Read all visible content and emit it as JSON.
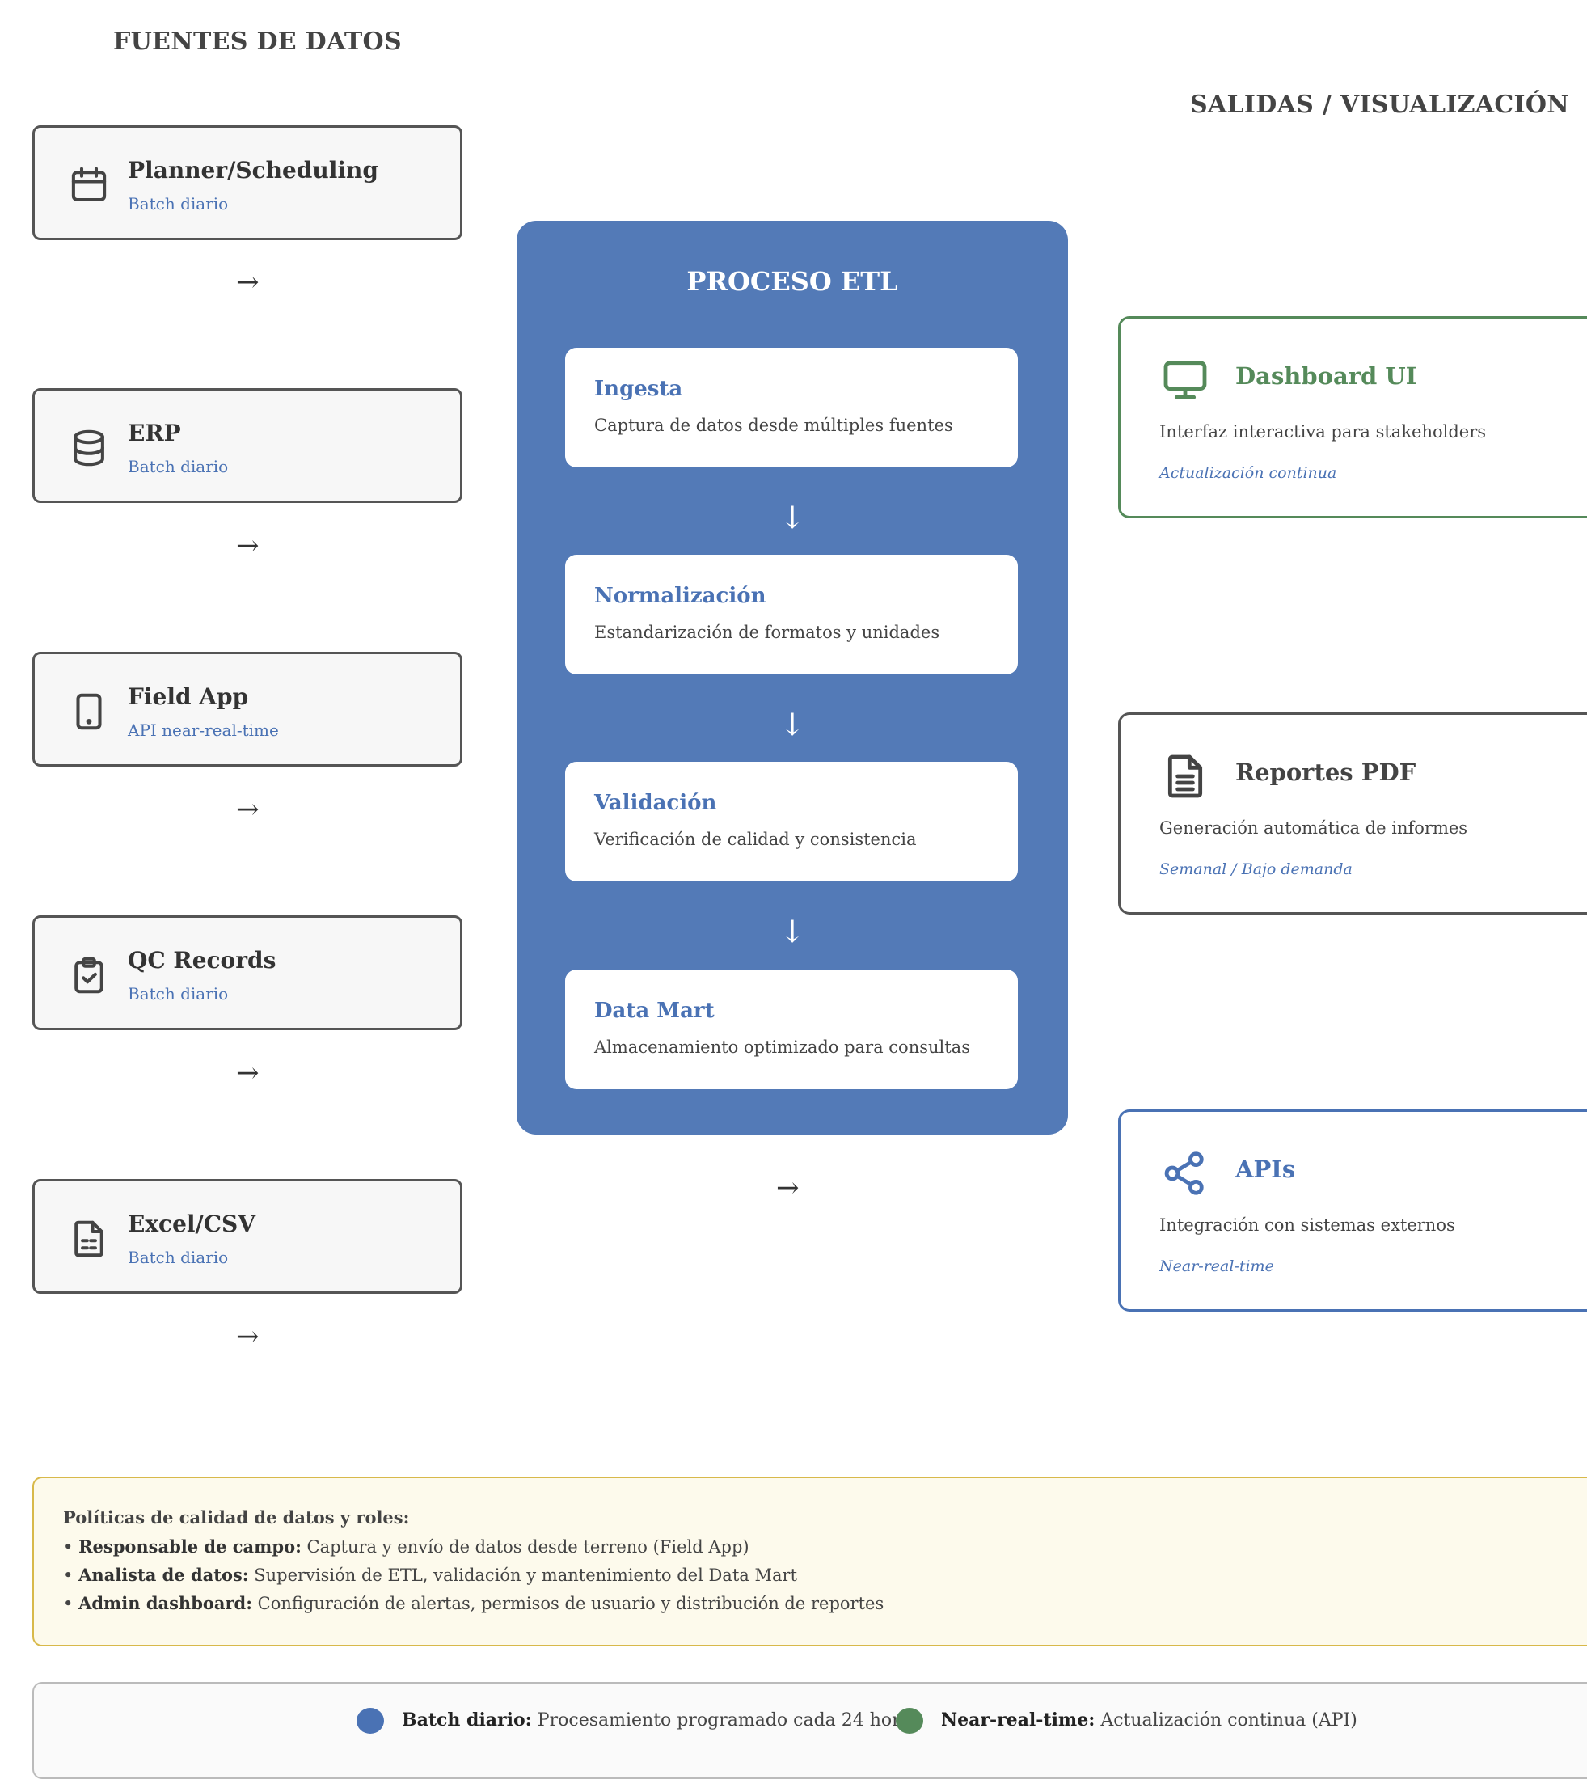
{
  "sources": {
    "title": "FUENTES DE DATOS",
    "items": [
      {
        "name": "Planner/Scheduling",
        "freq": "Batch diario",
        "icon": "calendar-icon"
      },
      {
        "name": "ERP",
        "freq": "Batch diario",
        "icon": "database-icon"
      },
      {
        "name": "Field App",
        "freq": "API near-real-time",
        "icon": "tablet-icon"
      },
      {
        "name": "QC Records",
        "freq": "Batch diario",
        "icon": "clipboard-check-icon"
      },
      {
        "name": "Excel/CSV",
        "freq": "Batch diario",
        "icon": "spreadsheet-file-icon"
      }
    ],
    "arrow": "→"
  },
  "etl": {
    "title": "PROCESO ETL",
    "steps": [
      {
        "name": "Ingesta",
        "desc": "Captura de datos desde múltiples fuentes"
      },
      {
        "name": "Normalización",
        "desc": "Estandarización de formatos y unidades"
      },
      {
        "name": "Validación",
        "desc": "Verificación de calidad y consistencia"
      },
      {
        "name": "Data Mart",
        "desc": "Almacenamiento optimizado para consultas"
      }
    ],
    "down_arrow": "↓",
    "out_arrow": "→"
  },
  "outputs": {
    "title": "SALIDAS / VISUALIZACIÓN",
    "items": [
      {
        "name": "Dashboard UI",
        "desc": "Interfaz interactiva para stakeholders",
        "freq": "Actualización continua",
        "icon": "monitor-icon",
        "color": "#558a5a"
      },
      {
        "name": "Reportes PDF",
        "desc": "Generación automática de informes",
        "freq": "Semanal / Bajo demanda",
        "icon": "document-icon",
        "color": "#555555"
      },
      {
        "name": "APIs",
        "desc": "Integración con sistemas externos",
        "freq": "Near-real-time",
        "icon": "share-icon",
        "color": "#4a72b4"
      }
    ]
  },
  "policies": {
    "title": "Políticas de calidad de datos y roles:",
    "items": [
      {
        "role": "Responsable de campo:",
        "text": " Captura y envío de datos desde terreno (Field App)"
      },
      {
        "role": "Analista de datos:",
        "text": " Supervisión de ETL, validación y mantenimiento del Data Mart"
      },
      {
        "role": "Admin dashboard:",
        "text": " Configuración de alertas, permisos de usuario y distribución de reportes"
      }
    ],
    "bullet": "• "
  },
  "legend": {
    "items": [
      {
        "label": "Batch diario:",
        "text": " Procesamiento programado cada 24 horas",
        "color": "#4a72b4"
      },
      {
        "label": "Near-real-time:",
        "text": " Actualización continua (API)",
        "color": "#558a5a"
      }
    ]
  }
}
